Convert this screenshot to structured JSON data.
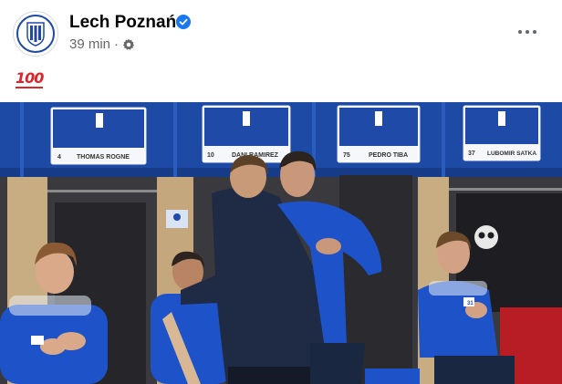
{
  "post": {
    "page_name": "Lech Poznań",
    "timestamp": "39 min",
    "separator": "·",
    "audience_icon": "gear-icon",
    "verified_icon": "verified-badge-icon",
    "caption_emoji": "100",
    "more_icon": "more-options-icon"
  },
  "photo": {
    "lockers": [
      {
        "number": "4",
        "name": "THOMAS ROGNE"
      },
      {
        "number": "10",
        "name": "DANI RAMIREZ"
      },
      {
        "number": "75",
        "name": "PEDRO TIBA"
      },
      {
        "number": "37",
        "name": "LUBOMIR SATKA"
      }
    ],
    "jersey_number": "31"
  },
  "colors": {
    "brand_blue": "#1f4aa8",
    "verified_blue": "#1877f2",
    "meta_gray": "#65676b"
  }
}
